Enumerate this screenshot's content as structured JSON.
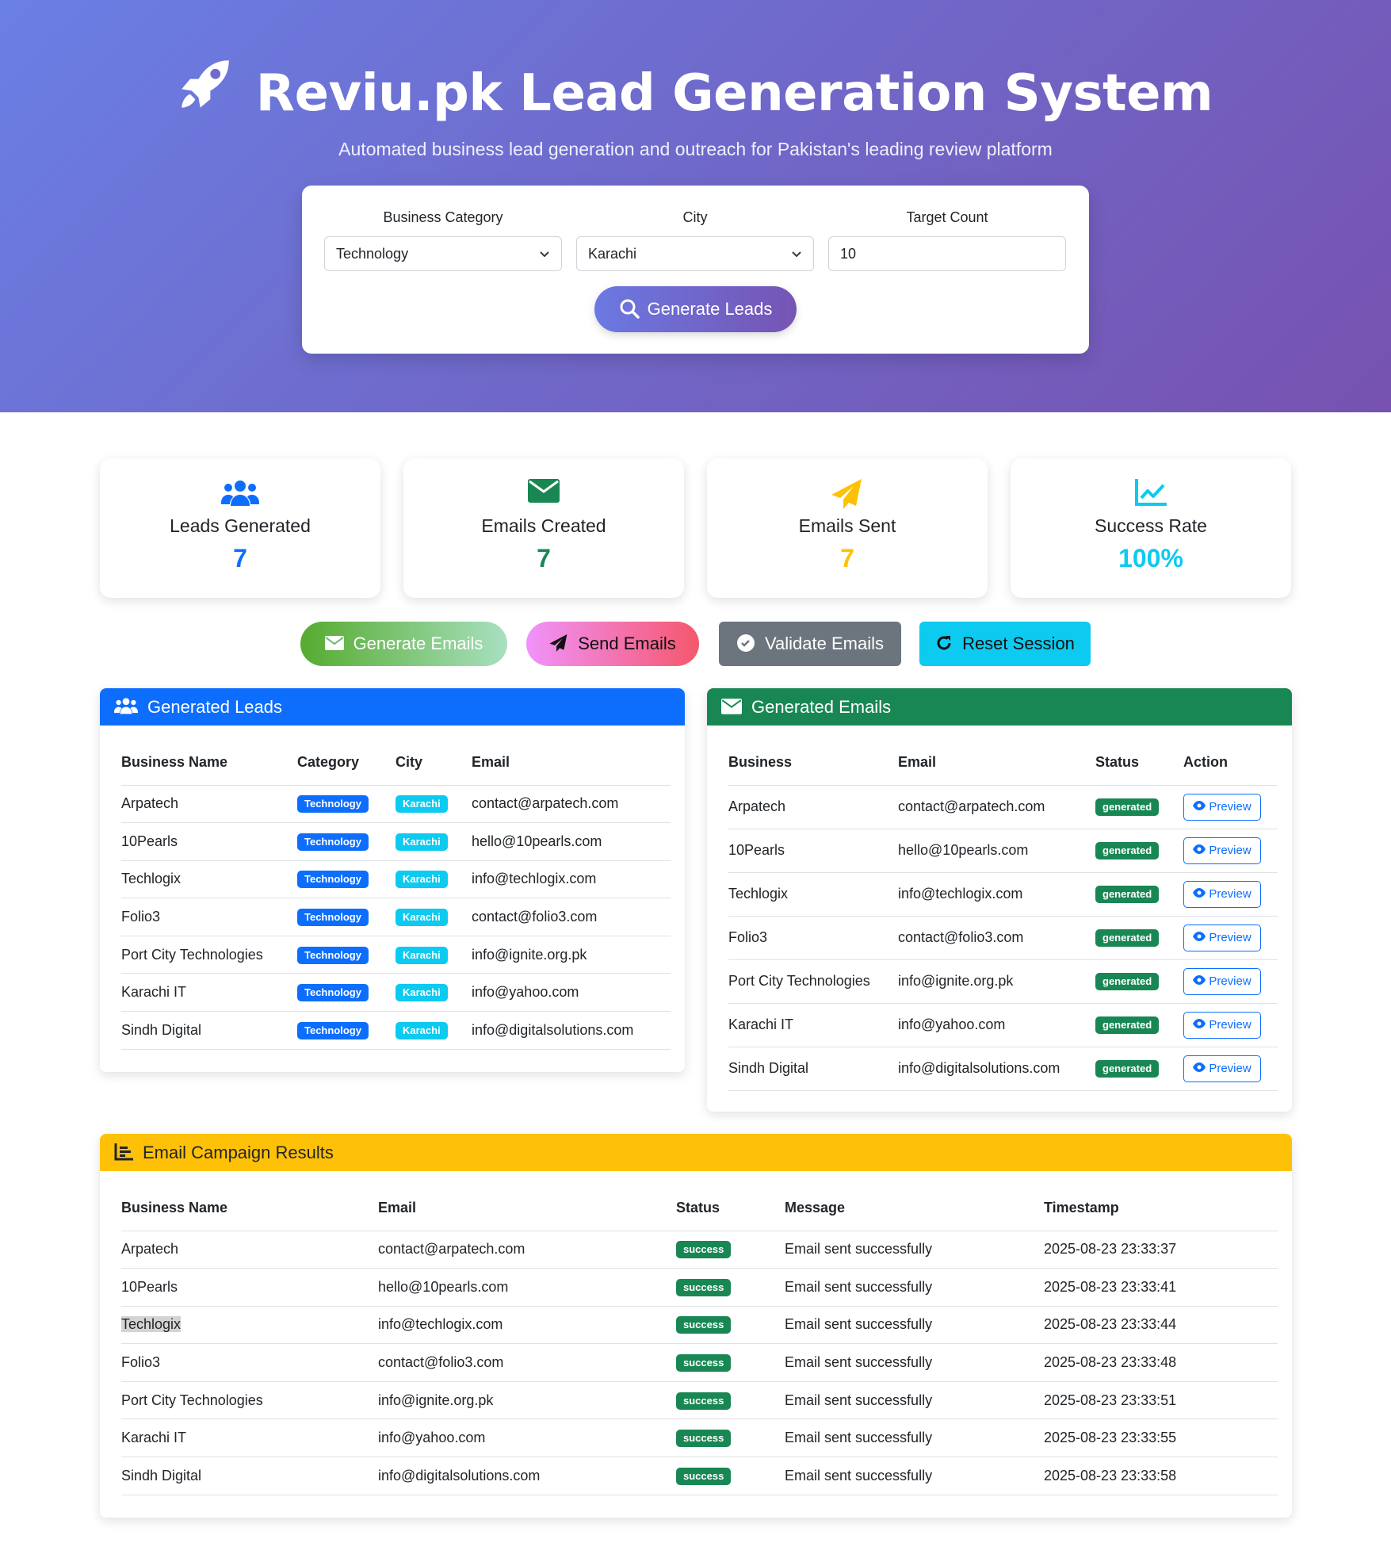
{
  "header": {
    "title": "Reviu.pk Lead Generation System",
    "subtitle": "Automated business lead generation and outreach for Pakistan's leading review platform"
  },
  "controls": {
    "category_label": "Business Category",
    "category_value": "Technology",
    "city_label": "City",
    "city_value": "Karachi",
    "target_label": "Target Count",
    "target_value": "10",
    "generate_label": "Generate Leads"
  },
  "stats": [
    {
      "label": "Leads Generated",
      "value": "7",
      "icon": "users-icon",
      "color": "#0d6efd"
    },
    {
      "label": "Emails Created",
      "value": "7",
      "icon": "envelope-icon",
      "color": "#198754"
    },
    {
      "label": "Emails Sent",
      "value": "7",
      "icon": "paper-plane-icon",
      "color": "#ffc107"
    },
    {
      "label": "Success Rate",
      "value": "100%",
      "icon": "chart-line-icon",
      "color": "#0dcaf0"
    }
  ],
  "actions": {
    "generate_emails": "Generate Emails",
    "send_emails": "Send Emails",
    "validate_emails": "Validate Emails",
    "reset_session": "Reset Session"
  },
  "leads": {
    "title": "Generated Leads",
    "headers": [
      "Business Name",
      "Category",
      "City",
      "Email"
    ],
    "rows": [
      [
        "Arpatech",
        "Technology",
        "Karachi",
        "contact@arpatech.com"
      ],
      [
        "10Pearls",
        "Technology",
        "Karachi",
        "hello@10pearls.com"
      ],
      [
        "Techlogix",
        "Technology",
        "Karachi",
        "info@techlogix.com"
      ],
      [
        "Folio3",
        "Technology",
        "Karachi",
        "contact@folio3.com"
      ],
      [
        "Port City Technologies",
        "Technology",
        "Karachi",
        "info@ignite.org.pk"
      ],
      [
        "Karachi IT",
        "Technology",
        "Karachi",
        "info@yahoo.com"
      ],
      [
        "Sindh Digital",
        "Technology",
        "Karachi",
        "info@digitalsolutions.com"
      ]
    ]
  },
  "emails": {
    "title": "Generated Emails",
    "headers": [
      "Business",
      "Email",
      "Status",
      "Action"
    ],
    "preview_label": "Preview",
    "rows": [
      [
        "Arpatech",
        "contact@arpatech.com",
        "generated"
      ],
      [
        "10Pearls",
        "hello@10pearls.com",
        "generated"
      ],
      [
        "Techlogix",
        "info@techlogix.com",
        "generated"
      ],
      [
        "Folio3",
        "contact@folio3.com",
        "generated"
      ],
      [
        "Port City Technologies",
        "info@ignite.org.pk",
        "generated"
      ],
      [
        "Karachi IT",
        "info@yahoo.com",
        "generated"
      ],
      [
        "Sindh Digital",
        "info@digitalsolutions.com",
        "generated"
      ]
    ]
  },
  "results": {
    "title": "Email Campaign Results",
    "headers": [
      "Business Name",
      "Email",
      "Status",
      "Message",
      "Timestamp"
    ],
    "rows": [
      [
        "Arpatech",
        "contact@arpatech.com",
        "success",
        "Email sent successfully",
        "2025-08-23 23:33:37"
      ],
      [
        "10Pearls",
        "hello@10pearls.com",
        "success",
        "Email sent successfully",
        "2025-08-23 23:33:41"
      ],
      [
        "Techlogix",
        "info@techlogix.com",
        "success",
        "Email sent successfully",
        "2025-08-23 23:33:44"
      ],
      [
        "Folio3",
        "contact@folio3.com",
        "success",
        "Email sent successfully",
        "2025-08-23 23:33:48"
      ],
      [
        "Port City Technologies",
        "info@ignite.org.pk",
        "success",
        "Email sent successfully",
        "2025-08-23 23:33:51"
      ],
      [
        "Karachi IT",
        "info@yahoo.com",
        "success",
        "Email sent successfully",
        "2025-08-23 23:33:55"
      ],
      [
        "Sindh Digital",
        "info@digitalsolutions.com",
        "success",
        "Email sent successfully",
        "2025-08-23 23:33:58"
      ]
    ]
  }
}
